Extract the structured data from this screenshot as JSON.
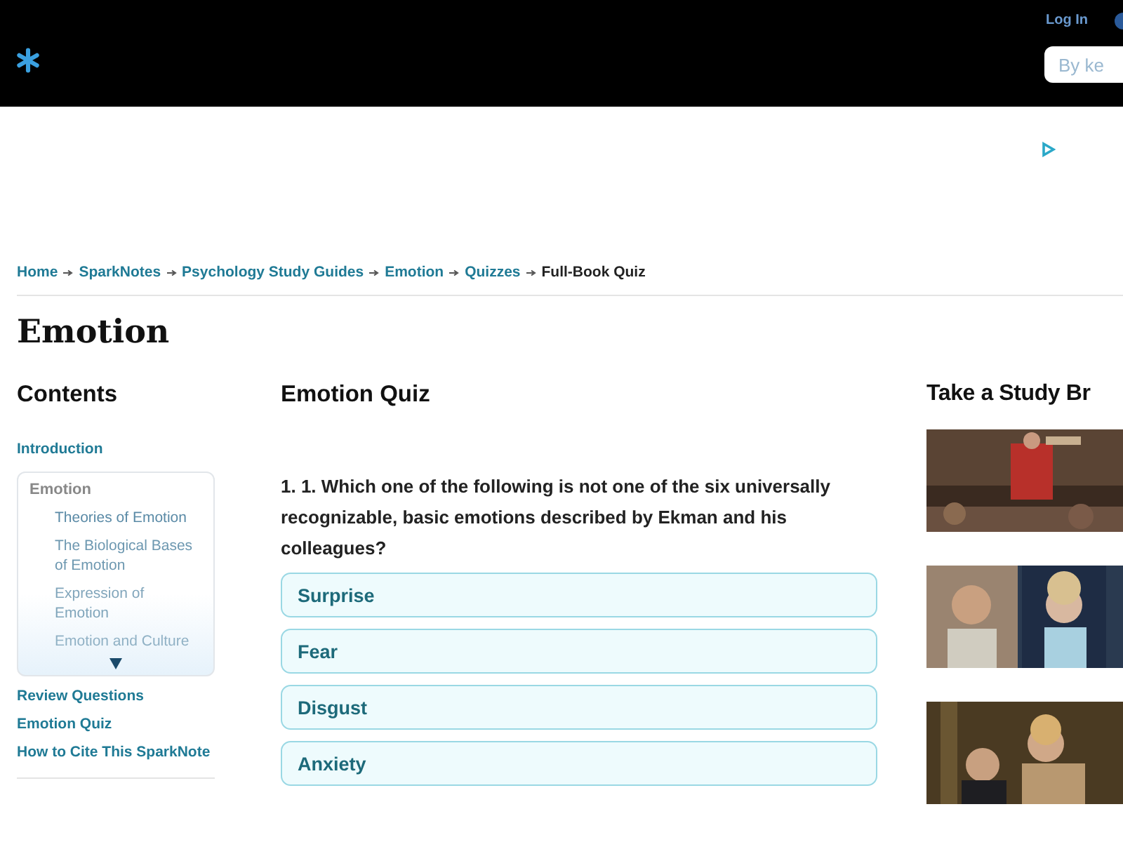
{
  "header": {
    "login": "Log In",
    "search": {
      "placeholder": "By ke"
    }
  },
  "breadcrumb": [
    {
      "label": "Home",
      "link": true
    },
    {
      "label": "SparkNotes",
      "link": true
    },
    {
      "label": "Psychology Study Guides",
      "link": true
    },
    {
      "label": "Emotion",
      "link": true
    },
    {
      "label": "Quizzes",
      "link": true
    },
    {
      "label": "Full-Book Quiz",
      "link": false
    }
  ],
  "title": "Emotion",
  "contents": {
    "heading": "Contents",
    "items": [
      {
        "label": "Introduction"
      },
      {
        "label": "Emotion",
        "children": [
          {
            "label": "Theories of Emotion"
          },
          {
            "label": "The Biological Bases of Emotion"
          },
          {
            "label": "Expression of Emotion"
          },
          {
            "label": "Emotion and Culture"
          }
        ]
      },
      {
        "label": "Review Questions"
      },
      {
        "label": "Emotion Quiz"
      },
      {
        "label": "How to Cite This SparkNote"
      }
    ]
  },
  "quiz": {
    "heading": "Emotion Quiz",
    "question": "1. 1. Which one of the following is not one of the six universally recognizable, basic emotions described by Ekman and his colleagues?",
    "answers": [
      "Surprise",
      "Fear",
      "Disgust",
      "Anxiety"
    ]
  },
  "study_break": {
    "heading": "Take a Study Br"
  }
}
